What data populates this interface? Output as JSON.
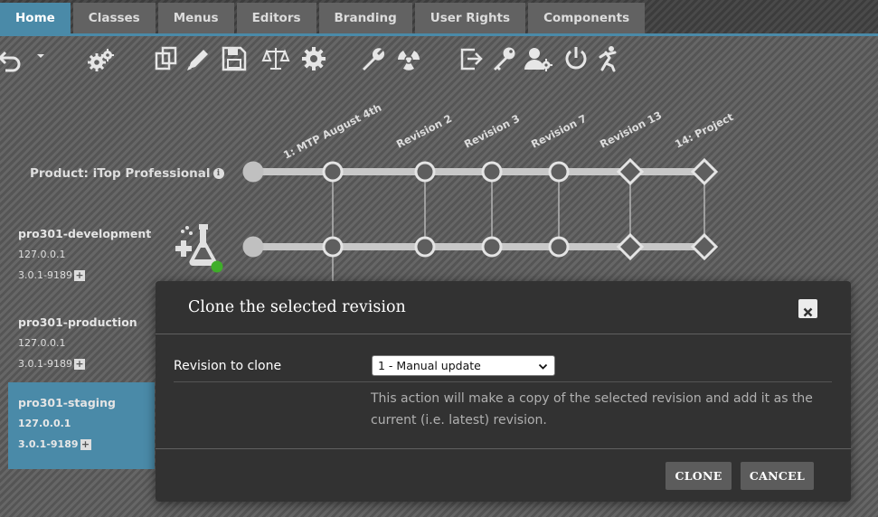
{
  "tabs": [
    {
      "label": "Home",
      "active": true
    },
    {
      "label": "Classes",
      "active": false
    },
    {
      "label": "Menus",
      "active": false
    },
    {
      "label": "Editors",
      "active": false
    },
    {
      "label": "Branding",
      "active": false
    },
    {
      "label": "User Rights",
      "active": false
    },
    {
      "label": "Components",
      "active": false
    }
  ],
  "toolbar": {
    "icons": [
      "undo-icon",
      "dropdown-arrow-icon",
      "gears-icon",
      "copy-icon",
      "edit-pen-icon",
      "save-icon",
      "scales-icon",
      "gear-icon",
      "wrench-icon",
      "radiation-icon",
      "export-icon",
      "key-icon",
      "user-settings-icon",
      "power-icon",
      "runner-icon"
    ]
  },
  "graph": {
    "revisions": [
      {
        "label": "1: MTP August 4th",
        "shape": "circle"
      },
      {
        "label": "Revision 2",
        "shape": "circle"
      },
      {
        "label": "Revision 3",
        "shape": "circle"
      },
      {
        "label": "Revision 7",
        "shape": "circle"
      },
      {
        "label": "Revision 13",
        "shape": "diamond"
      },
      {
        "label": "14: Project",
        "shape": "diamond"
      }
    ]
  },
  "product": {
    "label": "Product: iTop Professional",
    "info_glyph": "i"
  },
  "instances": [
    {
      "name": "pro301-development",
      "host": "127.0.0.1",
      "version": "3.0.1-9189",
      "selected": false
    },
    {
      "name": "pro301-production",
      "host": "127.0.0.1",
      "version": "3.0.1-9189",
      "selected": false
    },
    {
      "name": "pro301-staging",
      "host": "127.0.0.1",
      "version": "3.0.1-9189",
      "selected": true
    }
  ],
  "modal": {
    "title": "Clone the selected revision",
    "close_glyph": "×",
    "field_label": "Revision to clone",
    "select_value": "1 - Manual update",
    "help_text": "This action will make a copy of the selected revision and add it as the current (i.e. latest) revision.",
    "clone_label": "CLONE",
    "cancel_label": "CANCEL"
  },
  "colors": {
    "accent": "#4a8aa8",
    "status_green": "#3fae2a"
  }
}
